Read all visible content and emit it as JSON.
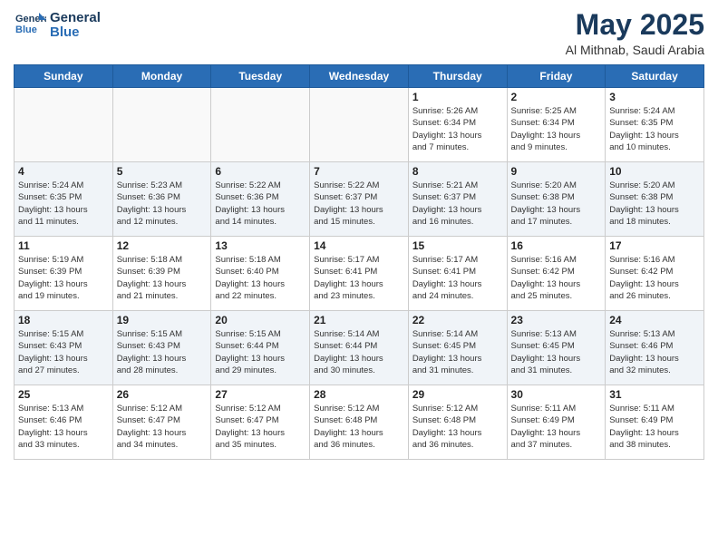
{
  "header": {
    "logo_line1": "General",
    "logo_line2": "Blue",
    "month_year": "May 2025",
    "location": "Al Mithnab, Saudi Arabia"
  },
  "weekdays": [
    "Sunday",
    "Monday",
    "Tuesday",
    "Wednesday",
    "Thursday",
    "Friday",
    "Saturday"
  ],
  "weeks": [
    [
      {
        "day": "",
        "info": ""
      },
      {
        "day": "",
        "info": ""
      },
      {
        "day": "",
        "info": ""
      },
      {
        "day": "",
        "info": ""
      },
      {
        "day": "1",
        "info": "Sunrise: 5:26 AM\nSunset: 6:34 PM\nDaylight: 13 hours\nand 7 minutes."
      },
      {
        "day": "2",
        "info": "Sunrise: 5:25 AM\nSunset: 6:34 PM\nDaylight: 13 hours\nand 9 minutes."
      },
      {
        "day": "3",
        "info": "Sunrise: 5:24 AM\nSunset: 6:35 PM\nDaylight: 13 hours\nand 10 minutes."
      }
    ],
    [
      {
        "day": "4",
        "info": "Sunrise: 5:24 AM\nSunset: 6:35 PM\nDaylight: 13 hours\nand 11 minutes."
      },
      {
        "day": "5",
        "info": "Sunrise: 5:23 AM\nSunset: 6:36 PM\nDaylight: 13 hours\nand 12 minutes."
      },
      {
        "day": "6",
        "info": "Sunrise: 5:22 AM\nSunset: 6:36 PM\nDaylight: 13 hours\nand 14 minutes."
      },
      {
        "day": "7",
        "info": "Sunrise: 5:22 AM\nSunset: 6:37 PM\nDaylight: 13 hours\nand 15 minutes."
      },
      {
        "day": "8",
        "info": "Sunrise: 5:21 AM\nSunset: 6:37 PM\nDaylight: 13 hours\nand 16 minutes."
      },
      {
        "day": "9",
        "info": "Sunrise: 5:20 AM\nSunset: 6:38 PM\nDaylight: 13 hours\nand 17 minutes."
      },
      {
        "day": "10",
        "info": "Sunrise: 5:20 AM\nSunset: 6:38 PM\nDaylight: 13 hours\nand 18 minutes."
      }
    ],
    [
      {
        "day": "11",
        "info": "Sunrise: 5:19 AM\nSunset: 6:39 PM\nDaylight: 13 hours\nand 19 minutes."
      },
      {
        "day": "12",
        "info": "Sunrise: 5:18 AM\nSunset: 6:39 PM\nDaylight: 13 hours\nand 21 minutes."
      },
      {
        "day": "13",
        "info": "Sunrise: 5:18 AM\nSunset: 6:40 PM\nDaylight: 13 hours\nand 22 minutes."
      },
      {
        "day": "14",
        "info": "Sunrise: 5:17 AM\nSunset: 6:41 PM\nDaylight: 13 hours\nand 23 minutes."
      },
      {
        "day": "15",
        "info": "Sunrise: 5:17 AM\nSunset: 6:41 PM\nDaylight: 13 hours\nand 24 minutes."
      },
      {
        "day": "16",
        "info": "Sunrise: 5:16 AM\nSunset: 6:42 PM\nDaylight: 13 hours\nand 25 minutes."
      },
      {
        "day": "17",
        "info": "Sunrise: 5:16 AM\nSunset: 6:42 PM\nDaylight: 13 hours\nand 26 minutes."
      }
    ],
    [
      {
        "day": "18",
        "info": "Sunrise: 5:15 AM\nSunset: 6:43 PM\nDaylight: 13 hours\nand 27 minutes."
      },
      {
        "day": "19",
        "info": "Sunrise: 5:15 AM\nSunset: 6:43 PM\nDaylight: 13 hours\nand 28 minutes."
      },
      {
        "day": "20",
        "info": "Sunrise: 5:15 AM\nSunset: 6:44 PM\nDaylight: 13 hours\nand 29 minutes."
      },
      {
        "day": "21",
        "info": "Sunrise: 5:14 AM\nSunset: 6:44 PM\nDaylight: 13 hours\nand 30 minutes."
      },
      {
        "day": "22",
        "info": "Sunrise: 5:14 AM\nSunset: 6:45 PM\nDaylight: 13 hours\nand 31 minutes."
      },
      {
        "day": "23",
        "info": "Sunrise: 5:13 AM\nSunset: 6:45 PM\nDaylight: 13 hours\nand 31 minutes."
      },
      {
        "day": "24",
        "info": "Sunrise: 5:13 AM\nSunset: 6:46 PM\nDaylight: 13 hours\nand 32 minutes."
      }
    ],
    [
      {
        "day": "25",
        "info": "Sunrise: 5:13 AM\nSunset: 6:46 PM\nDaylight: 13 hours\nand 33 minutes."
      },
      {
        "day": "26",
        "info": "Sunrise: 5:12 AM\nSunset: 6:47 PM\nDaylight: 13 hours\nand 34 minutes."
      },
      {
        "day": "27",
        "info": "Sunrise: 5:12 AM\nSunset: 6:47 PM\nDaylight: 13 hours\nand 35 minutes."
      },
      {
        "day": "28",
        "info": "Sunrise: 5:12 AM\nSunset: 6:48 PM\nDaylight: 13 hours\nand 36 minutes."
      },
      {
        "day": "29",
        "info": "Sunrise: 5:12 AM\nSunset: 6:48 PM\nDaylight: 13 hours\nand 36 minutes."
      },
      {
        "day": "30",
        "info": "Sunrise: 5:11 AM\nSunset: 6:49 PM\nDaylight: 13 hours\nand 37 minutes."
      },
      {
        "day": "31",
        "info": "Sunrise: 5:11 AM\nSunset: 6:49 PM\nDaylight: 13 hours\nand 38 minutes."
      }
    ]
  ]
}
